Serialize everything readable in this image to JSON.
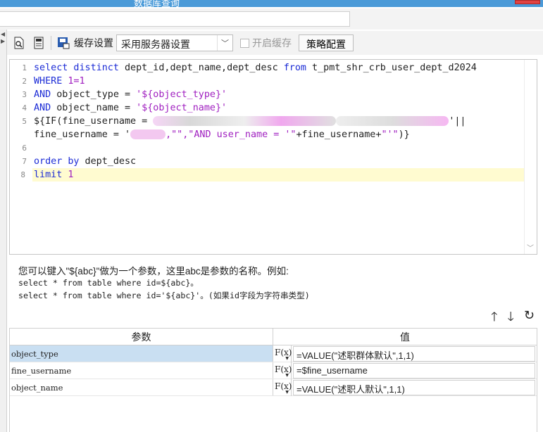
{
  "window": {
    "title": "数据库查询"
  },
  "toolbar": {
    "cache_settings_label": "缓存设置",
    "cache_select_value": "采用服务器设置",
    "enable_cache_label": "开启缓存",
    "strategy_button": "策略配置"
  },
  "editor": {
    "line_numbers": [
      "1",
      "2",
      "3",
      "4",
      "5",
      "",
      "6",
      "7",
      "8"
    ],
    "line1_kw1": "select distinct",
    "line1_mid": " dept_id,dept_name,dept_desc ",
    "line1_kw2": "from",
    "line1_tail": " t_pmt_shr_crb_user_dept_d2024",
    "line2_kw": "WHERE",
    "line2_num": " 1=1",
    "line3_kw": "AND",
    "line3_mid": " object_type = ",
    "line3_str": "'${object_type}'",
    "line4_kw": "AND",
    "line4_mid": " object_name = ",
    "line4_str": "'${object_name}'",
    "line5_a": "${IF(fine_username = ",
    "line5_b": "'||",
    "line5c_a": "fine_username = '",
    "line5c_str": ",\"\",\"AND user_name = '\"",
    "line5c_b": "+fine_username+",
    "line5c_str2": "\"'\"",
    "line5c_c": ")}",
    "line7_kw": "order by",
    "line7_tail": " dept_desc",
    "line8_kw": "limit",
    "line8_num": " 1"
  },
  "hint": {
    "line1": "您可以键入\"${abc}\"做为一个参数，这里abc是参数的名称。例如:",
    "line2": "select * from table where id=${abc}。",
    "line3": "select * from table where id='${abc}'。(如果id字段为字符串类型)"
  },
  "param_table": {
    "headers": {
      "param": "参数",
      "value": "值"
    },
    "rows": [
      {
        "name": "object_type",
        "value": "=VALUE(\"述职群体默认\",1,1)"
      },
      {
        "name": "fine_username",
        "value": "=$fine_username"
      },
      {
        "name": "object_name",
        "value": "=VALUE(\"述职人默认\",1,1)"
      }
    ],
    "fx_label": "F(x)"
  },
  "colors": {
    "keyword": "#1c2cd6",
    "string": "#a020c0",
    "selected_row": "#c9dff2",
    "highlight_line": "#fffbd0"
  }
}
